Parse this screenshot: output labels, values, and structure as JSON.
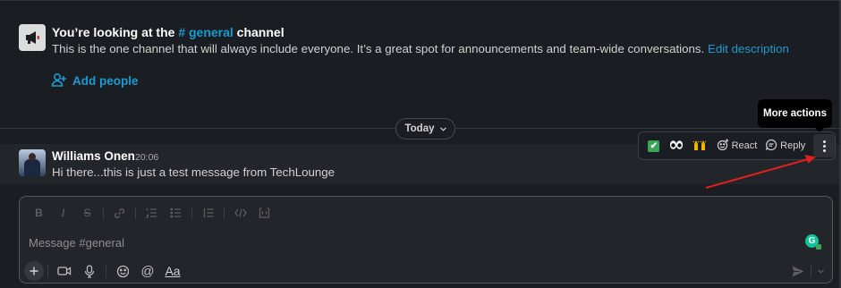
{
  "colors": {
    "background": "#1a1d21",
    "message_hover": "#222529",
    "link": "#1d9bd1",
    "annotation_arrow": "#e0201f",
    "check_emoji": "#3aa757",
    "grammarly": "#15c39a"
  },
  "channel_intro": {
    "icon": "megaphone-icon",
    "title_prefix": "You’re looking at the ",
    "channel_name": "# general",
    "title_suffix": " channel",
    "description": "This is the one channel that will always include everyone. It’s a great spot for announcements and team-wide conversations. ",
    "edit_link": "Edit description",
    "add_people_icon": "add-person-icon",
    "add_people": "Add people"
  },
  "divider": {
    "label": "Today",
    "icon": "chevron-down-icon"
  },
  "tooltip": {
    "text": "More actions"
  },
  "message": {
    "author": "Williams Onen",
    "time": "20:06",
    "text": "Hi there...this is just a test message from TechLounge"
  },
  "message_actions": {
    "quick_reactions": [
      "✔",
      "👀",
      "🙌"
    ],
    "react_label": "React",
    "react_icon": "add-reaction-icon",
    "reply_label": "Reply",
    "reply_icon": "reply-thread-icon",
    "more_icon": "vertical-dots-icon"
  },
  "composer": {
    "placeholder": "Message #general",
    "formatting": [
      "bold",
      "italic",
      "strikethrough",
      "link",
      "ordered-list",
      "bulleted-list",
      "blockquote",
      "code",
      "code-block"
    ],
    "format_glyphs": {
      "bold": "B",
      "italic": "I",
      "strikethrough": "S"
    },
    "grammarly_letter": "G",
    "plus_icon": "plus-icon",
    "bottom_tools": [
      "video-icon",
      "microphone-icon",
      "emoji-icon",
      "mention-icon"
    ],
    "mention_glyph": "@",
    "text_format_label": "Aa",
    "send_icon": "send-icon",
    "send_options_icon": "chevron-down-icon"
  }
}
